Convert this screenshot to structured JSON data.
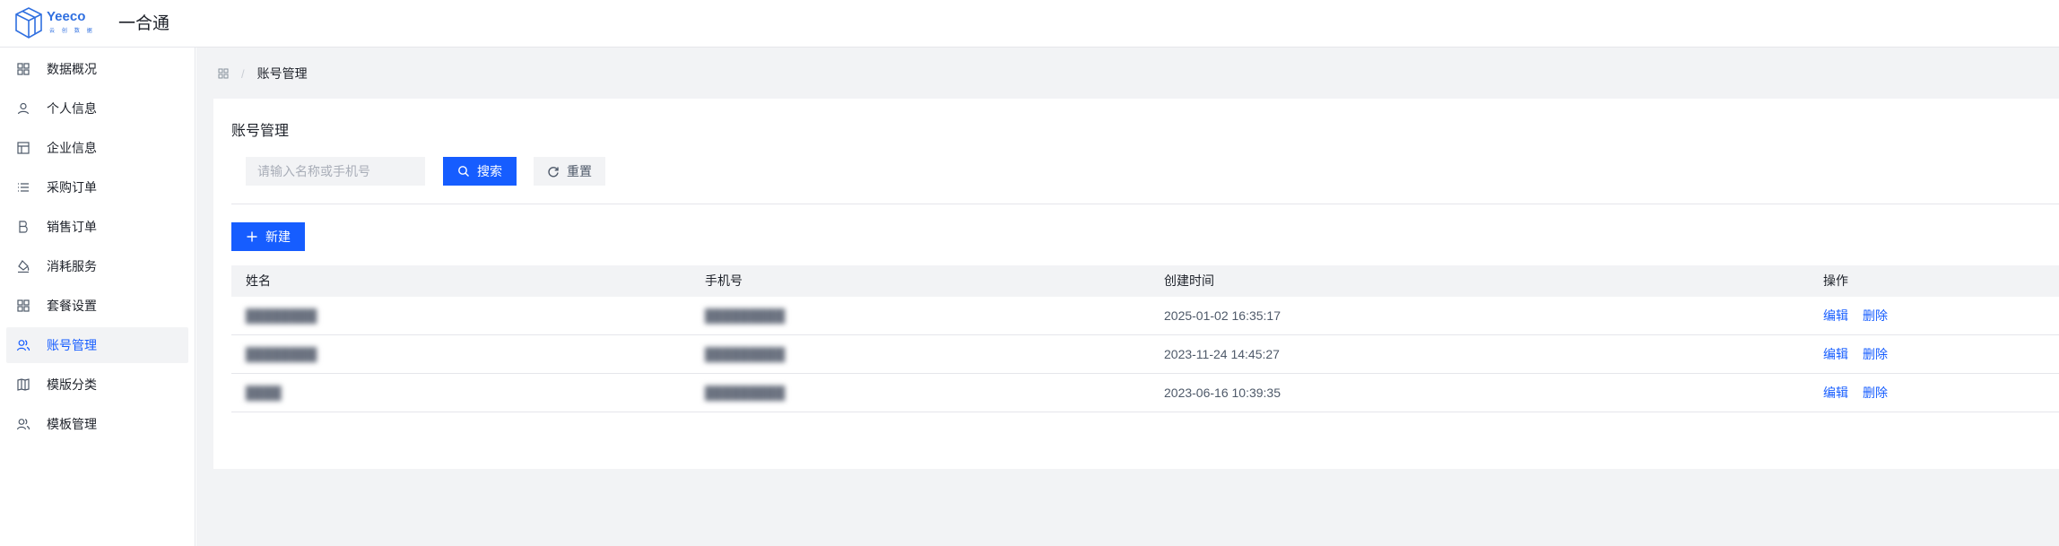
{
  "header": {
    "logo_text": "Yeeco",
    "logo_subtext": "云 创 数 据",
    "app_title": "一合通"
  },
  "sidebar": {
    "items": [
      {
        "label": "数据概况",
        "icon": "grid-icon"
      },
      {
        "label": "个人信息",
        "icon": "user-icon"
      },
      {
        "label": "企业信息",
        "icon": "layout-icon"
      },
      {
        "label": "采购订单",
        "icon": "list-icon"
      },
      {
        "label": "销售订单",
        "icon": "bold-b-icon"
      },
      {
        "label": "消耗服务",
        "icon": "paint-bucket-icon"
      },
      {
        "label": "套餐设置",
        "icon": "grid-icon"
      },
      {
        "label": "账号管理",
        "icon": "user-group-icon",
        "active": true
      },
      {
        "label": "模版分类",
        "icon": "book-icon"
      },
      {
        "label": "模板管理",
        "icon": "user-group-icon"
      }
    ]
  },
  "breadcrumb": {
    "separator": "/",
    "current": "账号管理"
  },
  "page": {
    "title": "账号管理",
    "search_placeholder": "请输入名称或手机号",
    "search_label": "搜索",
    "reset_label": "重置",
    "new_label": "新建"
  },
  "table": {
    "headers": {
      "name": "姓名",
      "phone": "手机号",
      "created": "创建时间",
      "actions": "操作"
    },
    "rows": [
      {
        "name": "████████",
        "phone": "█████████",
        "created": "2025-01-02 16:35:17",
        "edit": "编辑",
        "delete": "删除"
      },
      {
        "name": "████████",
        "phone": "█████████",
        "created": "2023-11-24 14:45:27",
        "edit": "编辑",
        "delete": "删除"
      },
      {
        "name": "████",
        "phone": "█████████",
        "created": "2023-06-16 10:39:35",
        "edit": "编辑",
        "delete": "删除"
      }
    ]
  },
  "colors": {
    "primary": "#165dff",
    "background": "#f2f3f5",
    "border": "#e5e6eb"
  }
}
